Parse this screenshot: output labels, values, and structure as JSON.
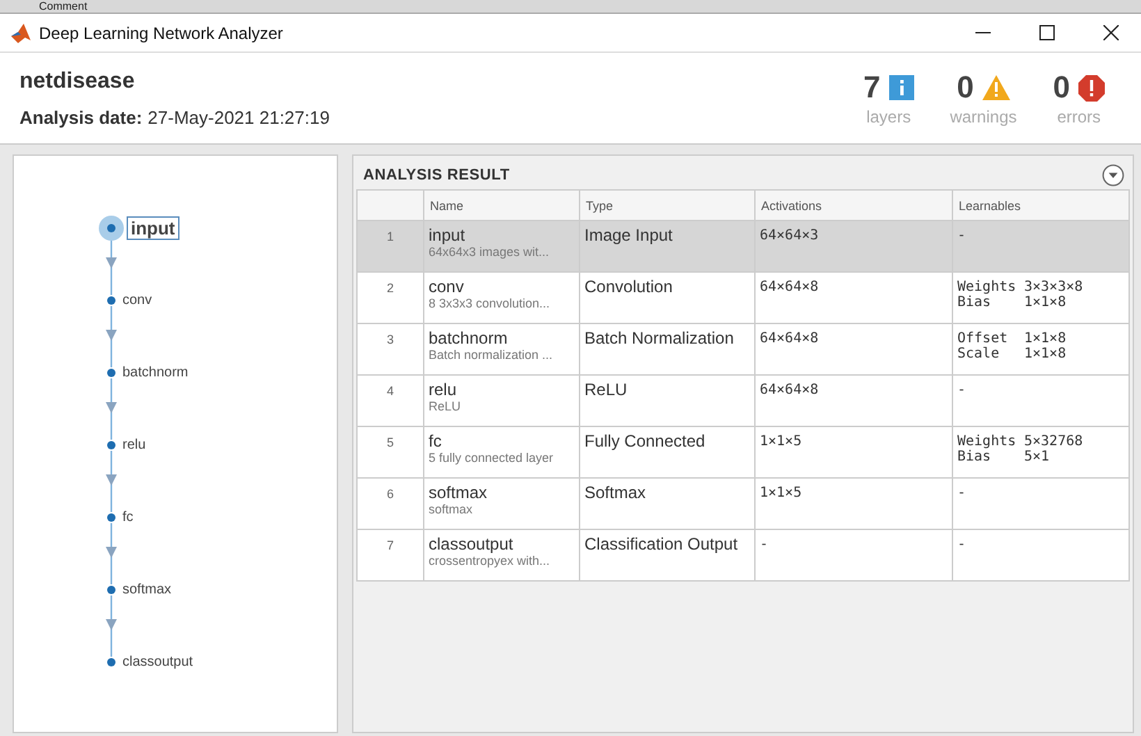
{
  "background_window": {
    "toolbar_label": "Comment"
  },
  "window": {
    "title": "Deep Learning Network Analyzer"
  },
  "header": {
    "network_name": "netdisease",
    "date_label": "Analysis date:",
    "date_value": "27-May-2021 21:27:19"
  },
  "summary": [
    {
      "kind": "info",
      "count": "7",
      "label": "layers"
    },
    {
      "kind": "warning",
      "count": "0",
      "label": "warnings"
    },
    {
      "kind": "error",
      "count": "0",
      "label": "errors"
    }
  ],
  "graph": {
    "nodes": [
      {
        "label": "input",
        "selected": true
      },
      {
        "label": "conv",
        "selected": false
      },
      {
        "label": "batchnorm",
        "selected": false
      },
      {
        "label": "relu",
        "selected": false
      },
      {
        "label": "fc",
        "selected": false
      },
      {
        "label": "softmax",
        "selected": false
      },
      {
        "label": "classoutput",
        "selected": false
      }
    ]
  },
  "analysis": {
    "title": "ANALYSIS RESULT",
    "columns": [
      "Name",
      "Type",
      "Activations",
      "Learnables"
    ],
    "rows": [
      {
        "index": "1",
        "name": "input",
        "description": "64x64x3 images wit...",
        "type": "Image Input",
        "activations": "64×64×3",
        "learnables": "-",
        "selected": true
      },
      {
        "index": "2",
        "name": "conv",
        "description": "8 3x3x3 convolution...",
        "type": "Convolution",
        "activations": "64×64×8",
        "learnables": [
          {
            "param": "Weights",
            "size": "3×3×3×8"
          },
          {
            "param": "Bias",
            "size": "1×1×8"
          }
        ],
        "selected": false
      },
      {
        "index": "3",
        "name": "batchnorm",
        "description": "Batch normalization ...",
        "type": "Batch Normalization",
        "activations": "64×64×8",
        "learnables": [
          {
            "param": "Offset",
            "size": "1×1×8"
          },
          {
            "param": "Scale",
            "size": "1×1×8"
          }
        ],
        "selected": false
      },
      {
        "index": "4",
        "name": "relu",
        "description": "ReLU",
        "type": "ReLU",
        "activations": "64×64×8",
        "learnables": "-",
        "selected": false
      },
      {
        "index": "5",
        "name": "fc",
        "description": "5 fully connected layer",
        "type": "Fully Connected",
        "activations": "1×1×5",
        "learnables": [
          {
            "param": "Weights",
            "size": "5×32768"
          },
          {
            "param": "Bias",
            "size": "5×1"
          }
        ],
        "selected": false
      },
      {
        "index": "6",
        "name": "softmax",
        "description": "softmax",
        "type": "Softmax",
        "activations": "1×1×5",
        "learnables": "-",
        "selected": false
      },
      {
        "index": "7",
        "name": "classoutput",
        "description": "crossentropyex with...",
        "type": "Classification Output",
        "activations": "-",
        "learnables": "-",
        "selected": false
      }
    ]
  }
}
